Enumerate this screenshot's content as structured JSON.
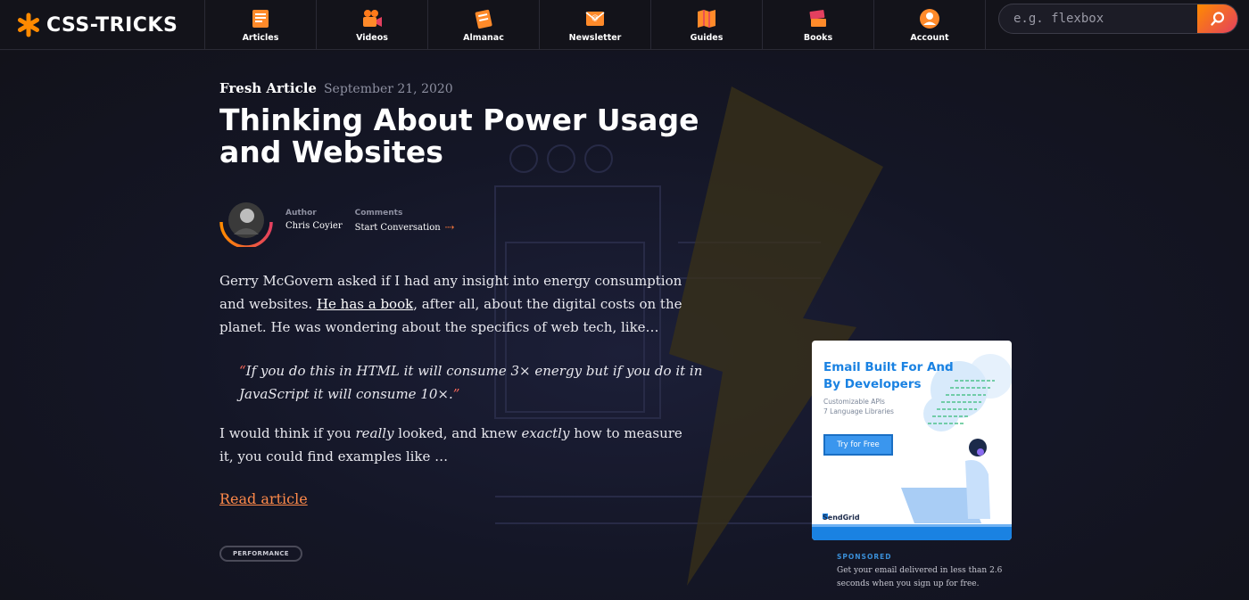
{
  "site": {
    "name": "CSS-TRICKS"
  },
  "nav": [
    {
      "label": "Articles",
      "icon": "articles-icon"
    },
    {
      "label": "Videos",
      "icon": "videos-icon"
    },
    {
      "label": "Almanac",
      "icon": "almanac-icon"
    },
    {
      "label": "Newsletter",
      "icon": "newsletter-icon"
    },
    {
      "label": "Guides",
      "icon": "guides-icon"
    },
    {
      "label": "Books",
      "icon": "books-icon"
    },
    {
      "label": "Account",
      "icon": "account-icon"
    }
  ],
  "search": {
    "placeholder": "e.g. flexbox"
  },
  "article": {
    "kicker": "Fresh Article",
    "date": "September 21, 2020",
    "title": "Thinking About Power Usage and Websites",
    "author_label": "Author",
    "author_name": "Chris Coyier",
    "comments_label": "Comments",
    "comments_value": "Start Conversation",
    "p1_a": "Gerry McGovern asked if I had any insight into energy consumption and websites. ",
    "p1_link": "He has a book",
    "p1_b": ", after all, about the digital costs on the planet. He was wondering about the specifics of web tech, like…",
    "quote_open": "“",
    "quote": "If you do this in HTML it will consume 3× energy but if you do it in JavaScript it will consume 10×.",
    "quote_close": "”",
    "p2_a": "I would think if you ",
    "p2_em1": "really",
    "p2_b": " looked, and knew ",
    "p2_em2": "exactly",
    "p2_c": " how to measure it, you could find examples like …",
    "read_more": "Read article",
    "tag": "PERFORMANCE"
  },
  "ad": {
    "headline": "Email Built For And By Developers",
    "sub1": "Customizable APIs",
    "sub2": "7 Language Libraries",
    "button": "Try for Free",
    "logo": "SendGrid",
    "sponsored_label": "SPONSORED",
    "sponsored_text": "Get your email delivered in less than 2.6 seconds when you sign up for free."
  },
  "colors": {
    "accent_orange": "#ff8a00",
    "accent_pink": "#e4405f",
    "background": "#13131c",
    "ad_blue": "#1a82e2"
  }
}
